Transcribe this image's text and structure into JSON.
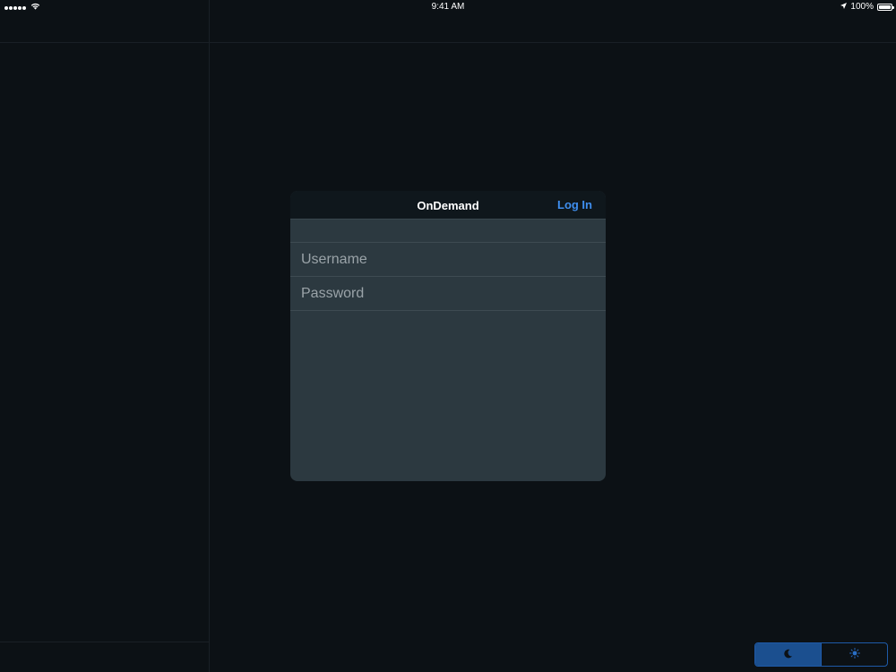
{
  "status_bar": {
    "time": "9:41 AM",
    "battery": "100%",
    "battery_level": 1.0,
    "icons": [
      "signal-dots-icon",
      "wifi-icon",
      "location-arrow-icon",
      "battery-icon"
    ]
  },
  "login": {
    "title": "OnDemand",
    "login_label": "Log In",
    "username_placeholder": "Username",
    "password_placeholder": "Password",
    "username_value": "",
    "password_value": ""
  },
  "theme_toggle": {
    "options": [
      "moon-icon",
      "sun-icon"
    ],
    "selected": "moon-icon"
  },
  "colors": {
    "background": "#0c1115",
    "modal": "#2c3940",
    "modal_header": "#0f171c",
    "accent": "#3f8ff0",
    "toggle_active": "#1b4f8f"
  }
}
